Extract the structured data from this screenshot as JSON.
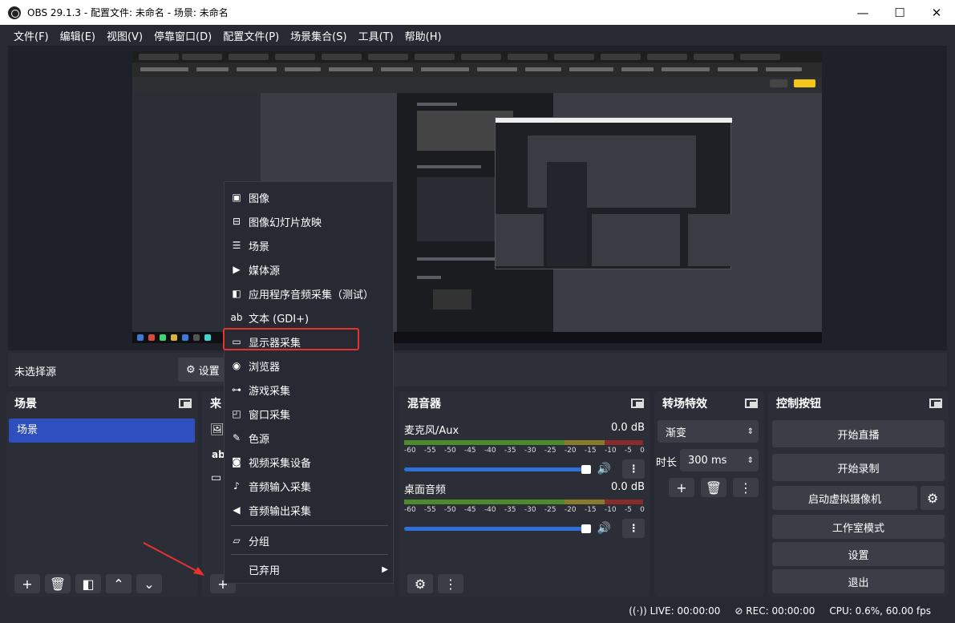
{
  "window": {
    "title": "OBS 29.1.3 - 配置文件: 未命名 - 场景: 未命名",
    "controls": [
      "—",
      "☐",
      "✕"
    ]
  },
  "menu_bar": [
    "文件(F)",
    "编辑(E)",
    "视图(V)",
    "停靠窗口(D)",
    "配置文件(P)",
    "场景集合(S)",
    "工具(T)",
    "帮助(H)"
  ],
  "source_bar": {
    "label": "未选择源",
    "settings_button": "设置"
  },
  "scenes": {
    "title": "场景",
    "items": [
      "场景"
    ]
  },
  "sources": {
    "title": "来"
  },
  "mixer": {
    "title": "混音器",
    "channels": [
      {
        "name": "麦克风/Aux",
        "db": "0.0 dB"
      },
      {
        "name": "桌面音频",
        "db": "0.0 dB"
      }
    ],
    "ticks": [
      "-60",
      "-55",
      "-50",
      "-45",
      "-40",
      "-35",
      "-30",
      "-25",
      "-20",
      "-15",
      "-10",
      "-5",
      "0"
    ]
  },
  "transitions": {
    "title": "转场特效",
    "type": "渐变",
    "duration_label": "时长",
    "duration": "300 ms"
  },
  "controls": {
    "title": "控制按钮",
    "buttons": [
      "开始直播",
      "开始录制",
      "启动虚拟摄像机",
      "工作室模式",
      "设置",
      "退出"
    ]
  },
  "add_source_menu": {
    "items": [
      {
        "label": "图像",
        "icon": "image-icon"
      },
      {
        "label": "图像幻灯片放映",
        "icon": "slideshow-icon"
      },
      {
        "label": "场景",
        "icon": "list-icon"
      },
      {
        "label": "媒体源",
        "icon": "play-icon"
      },
      {
        "label": "应用程序音频采集（测试）",
        "icon": "app-audio-icon"
      },
      {
        "label": "文本 (GDI+)",
        "icon": "text-icon"
      },
      {
        "label": "显示器采集",
        "icon": "monitor-icon"
      },
      {
        "label": "浏览器",
        "icon": "globe-icon"
      },
      {
        "label": "游戏采集",
        "icon": "gamepad-icon"
      },
      {
        "label": "窗口采集",
        "icon": "window-icon"
      },
      {
        "label": "色源",
        "icon": "brush-icon"
      },
      {
        "label": "视频采集设备",
        "icon": "camera-icon"
      },
      {
        "label": "音频输入采集",
        "icon": "mic-icon"
      },
      {
        "label": "音频输出采集",
        "icon": "speaker-icon"
      }
    ],
    "group": "分组",
    "deprecated": "已弃用"
  },
  "status": {
    "live": "LIVE: 00:00:00",
    "rec": "REC: 00:00:00",
    "cpu": "CPU: 0.6%, 60.00 fps"
  },
  "colors": {
    "background": "#272a33",
    "dock": "#2b2e36",
    "selection": "#2e4fbd",
    "highlight_box": "#e8322f",
    "slider": "#2f6fd6"
  }
}
